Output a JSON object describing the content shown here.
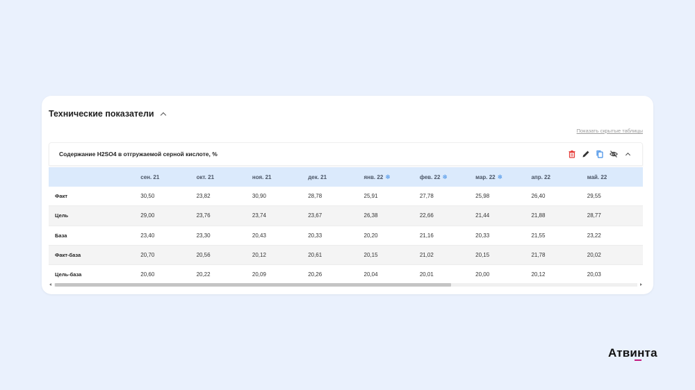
{
  "section": {
    "title": "Технические показатели"
  },
  "show_hidden_label": "Показать скрытые таблицы",
  "table": {
    "title": "Содержание H2SO4 в отгружаемой серной кислоте, %",
    "columns": [
      {
        "label": "сен. 21",
        "frozen": false
      },
      {
        "label": "окт. 21",
        "frozen": false
      },
      {
        "label": "ноя. 21",
        "frozen": false
      },
      {
        "label": "дек. 21",
        "frozen": false
      },
      {
        "label": "янв. 22",
        "frozen": true
      },
      {
        "label": "фев. 22",
        "frozen": true
      },
      {
        "label": "мар. 22",
        "frozen": true
      },
      {
        "label": "апр. 22",
        "frozen": false
      },
      {
        "label": "май. 22",
        "frozen": false
      }
    ],
    "rows": [
      {
        "label": "Факт",
        "values": [
          "30,50",
          "23,82",
          "30,90",
          "28,78",
          "25,91",
          "27,78",
          "25,98",
          "26,40",
          "29,55"
        ]
      },
      {
        "label": "Цель",
        "values": [
          "29,00",
          "23,76",
          "23,74",
          "23,67",
          "26,38",
          "22,66",
          "21,44",
          "21,88",
          "28,77"
        ]
      },
      {
        "label": "База",
        "values": [
          "23,40",
          "23,30",
          "20,43",
          "20,33",
          "20,20",
          "21,16",
          "20,33",
          "21,55",
          "23,22"
        ]
      },
      {
        "label": "Факт-база",
        "values": [
          "20,70",
          "20,56",
          "20,12",
          "20,61",
          "20,15",
          "21,02",
          "20,15",
          "21,78",
          "20,02"
        ]
      },
      {
        "label": "Цель-база",
        "values": [
          "20,60",
          "20,22",
          "20,09",
          "20,26",
          "20,04",
          "20,01",
          "20,00",
          "20,12",
          "20,03"
        ]
      }
    ],
    "scroll_position": 0.0
  },
  "icons": {
    "delete": "trash-icon",
    "edit": "pencil-icon",
    "copy": "copy-icon",
    "hide": "eye-off-icon",
    "collapse": "chevron-up-icon",
    "frozen": "snowflake-icon"
  },
  "colors": {
    "background": "#eaf1fd",
    "header_row": "#dbeafc",
    "delete": "#e53935",
    "accent": "#3f8de6",
    "brand_accent": "#c2187e"
  },
  "brand": {
    "name": "Атвинта"
  }
}
